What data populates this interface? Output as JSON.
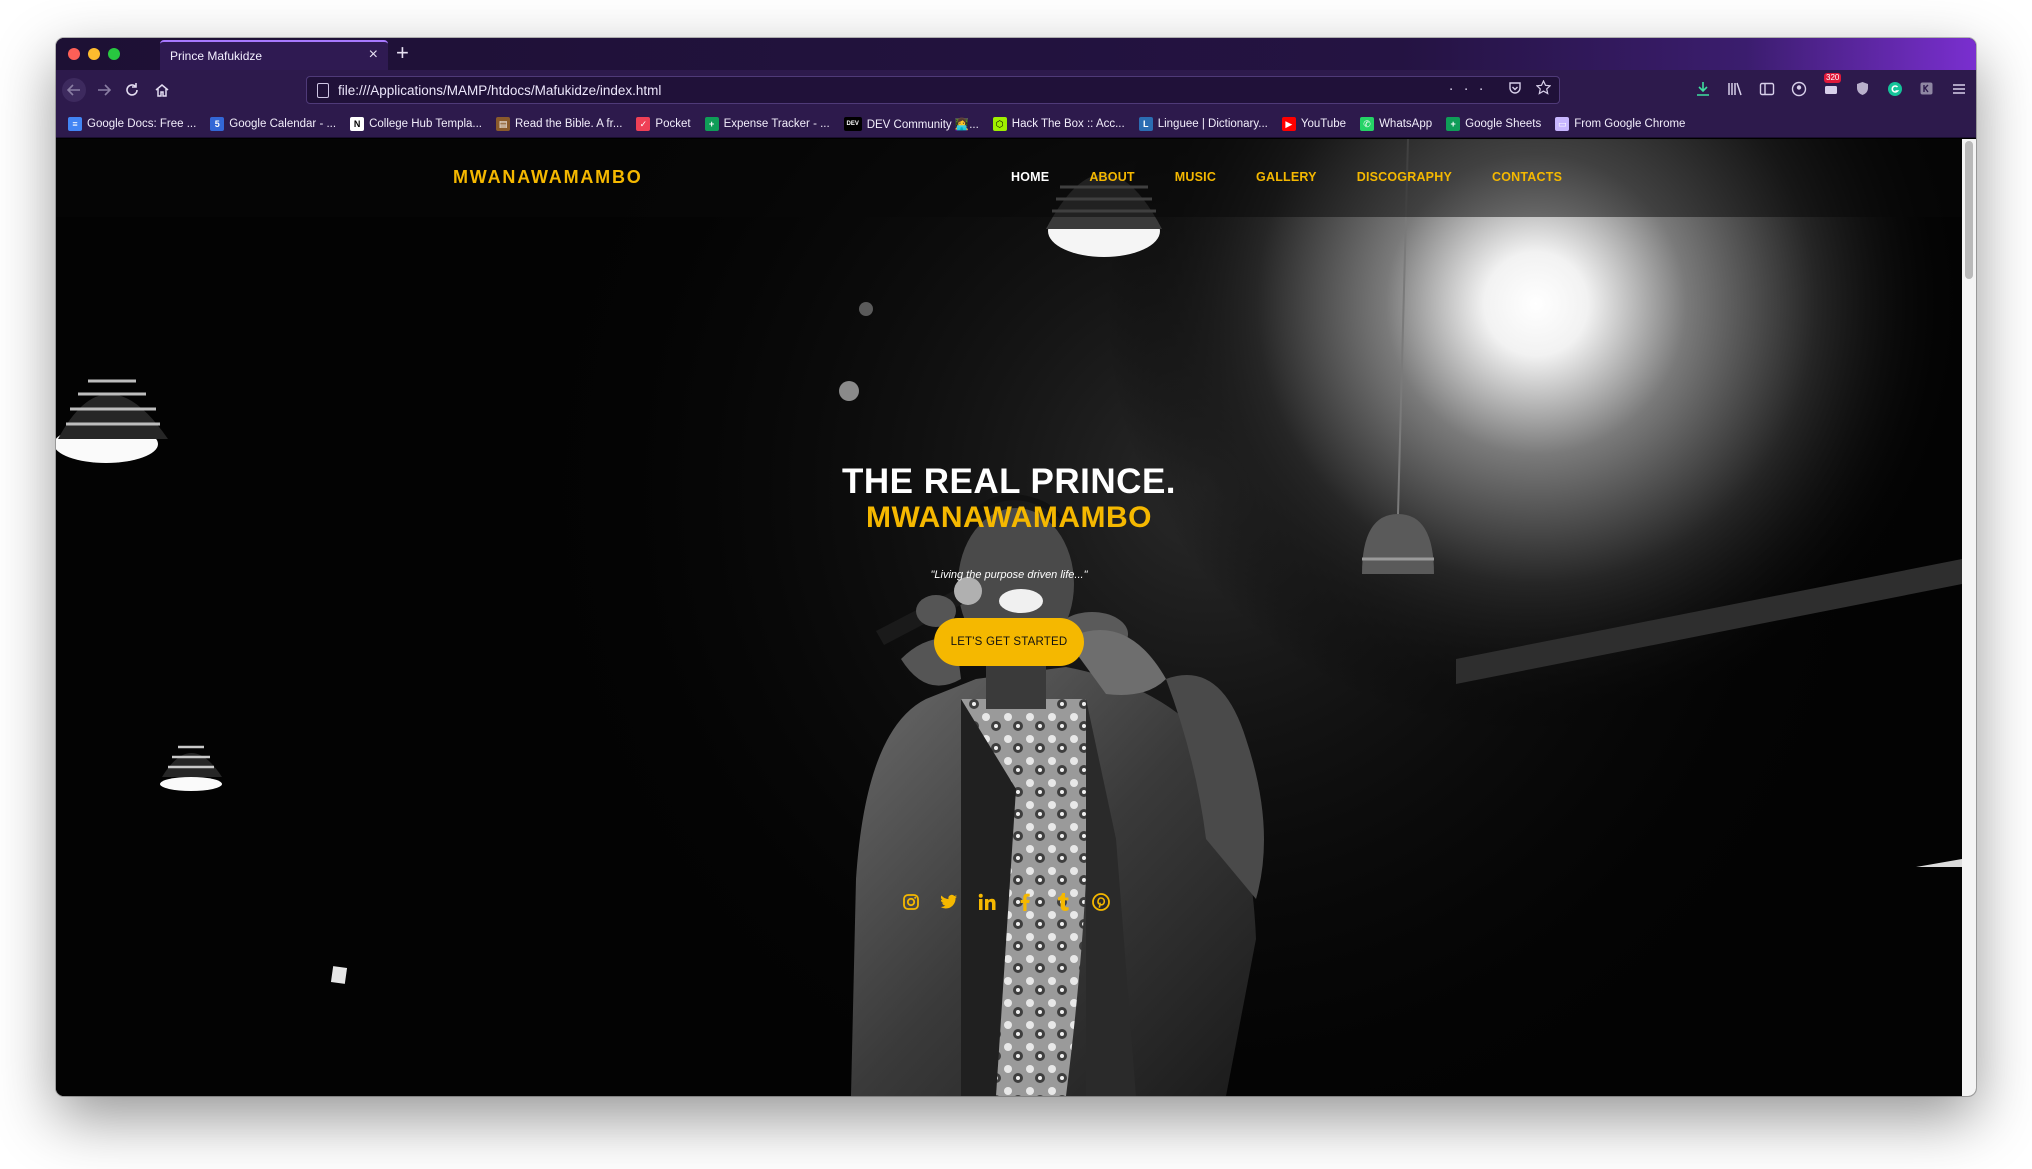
{
  "browser": {
    "tab_title": "Prince Mafukidze",
    "tab_close": "×",
    "new_tab": "+",
    "url": "file:///Applications/MAMP/htdocs/Mafukidze/index.html",
    "url_actions": "···",
    "notification_count": "320",
    "bookmarks": [
      {
        "label": "Google Docs: Free ...",
        "icon": "google-docs-icon",
        "color": "#4285f4",
        "glyph": "≡"
      },
      {
        "label": "Google Calendar - ...",
        "icon": "google-calendar-icon",
        "color": "#3367d6",
        "glyph": "5"
      },
      {
        "label": "College Hub Templa...",
        "icon": "notion-icon",
        "color": "#ffffff",
        "glyph": "N"
      },
      {
        "label": "Read the Bible. A fr...",
        "icon": "bible-icon",
        "color": "#8a5a2b",
        "glyph": "▤"
      },
      {
        "label": "Pocket",
        "icon": "pocket-icon",
        "color": "#ef4056",
        "glyph": "✓"
      },
      {
        "label": "Expense Tracker - ...",
        "icon": "google-sheets-icon",
        "color": "#0f9d58",
        "glyph": "+"
      },
      {
        "label": "DEV Community 👩‍💻...",
        "icon": "dev-icon",
        "color": "#000000",
        "glyph": "DEV"
      },
      {
        "label": "Hack The Box :: Acc...",
        "icon": "hackthebox-icon",
        "color": "#9fef00",
        "glyph": "⬡"
      },
      {
        "label": "Linguee | Dictionary...",
        "icon": "linguee-icon",
        "color": "#2b6db2",
        "glyph": "L"
      },
      {
        "label": "YouTube",
        "icon": "youtube-icon",
        "color": "#ff0000",
        "glyph": "▶"
      },
      {
        "label": "WhatsApp",
        "icon": "whatsapp-icon",
        "color": "#25d366",
        "glyph": "✆"
      },
      {
        "label": "Google Sheets",
        "icon": "google-sheets-icon",
        "color": "#0f9d58",
        "glyph": "+"
      },
      {
        "label": "From Google Chrome",
        "icon": "folder-icon",
        "color": "#c8b6ff",
        "glyph": "▭"
      }
    ]
  },
  "site": {
    "logo": "MWANAWAMAMBO",
    "nav": [
      {
        "label": "HOME",
        "active": true
      },
      {
        "label": "ABOUT",
        "active": false
      },
      {
        "label": "MUSIC",
        "active": false
      },
      {
        "label": "GALLERY",
        "active": false
      },
      {
        "label": "DISCOGRAPHY",
        "active": false
      },
      {
        "label": "CONTACTS",
        "active": false
      }
    ],
    "hero": {
      "title": "THE REAL PRINCE.",
      "subtitle": "MWANAWAMAMBO",
      "quote": "\"Living the purpose driven life...\"",
      "cta_label": "LET'S GET STARTED"
    },
    "socials": [
      "instagram-icon",
      "twitter-icon",
      "linkedin-icon",
      "facebook-icon",
      "tumblr-icon",
      "pinterest-icon"
    ]
  },
  "colors": {
    "accent": "#f5b800",
    "browser_chrome": "#2d1a4c",
    "page_background": "#030303"
  }
}
